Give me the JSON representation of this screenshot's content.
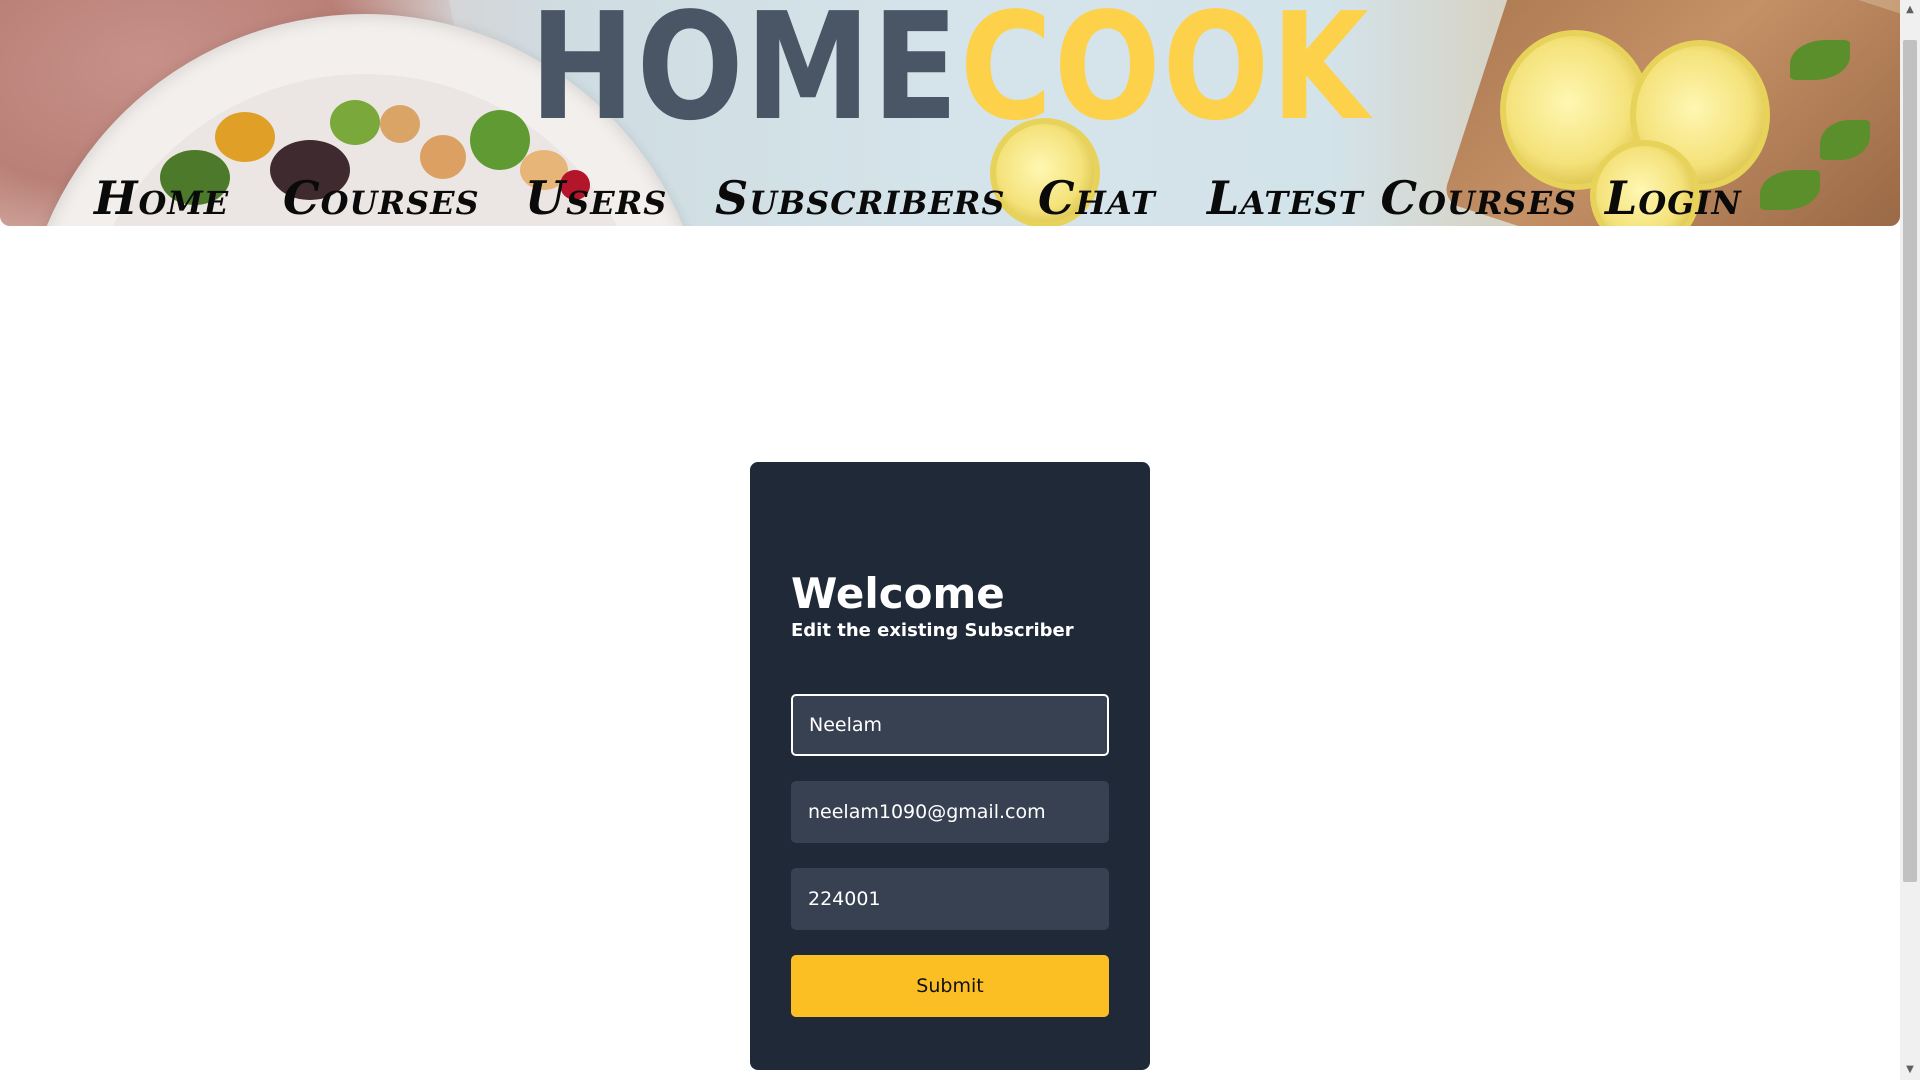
{
  "header": {
    "logo_part_a": "HOME",
    "logo_part_b": "COOK",
    "nav": [
      {
        "label": "Home"
      },
      {
        "label": "Courses"
      },
      {
        "label": "Users"
      },
      {
        "label": "Subscribers"
      },
      {
        "label": "Chat"
      },
      {
        "label": "Latest Courses"
      },
      {
        "label": "Login"
      }
    ]
  },
  "form": {
    "title": "Welcome",
    "subtitle": "Edit the existing Subscriber",
    "name_value": "Neelam",
    "email_value": "neelam1090@gmail.com",
    "zip_value": "224001",
    "submit_label": "Submit"
  },
  "colors": {
    "card_bg": "#1f2937",
    "input_bg": "#374151",
    "button_bg": "#fbbf24",
    "logo_gray": "#4a5566",
    "logo_yellow": "#fdd24a"
  }
}
